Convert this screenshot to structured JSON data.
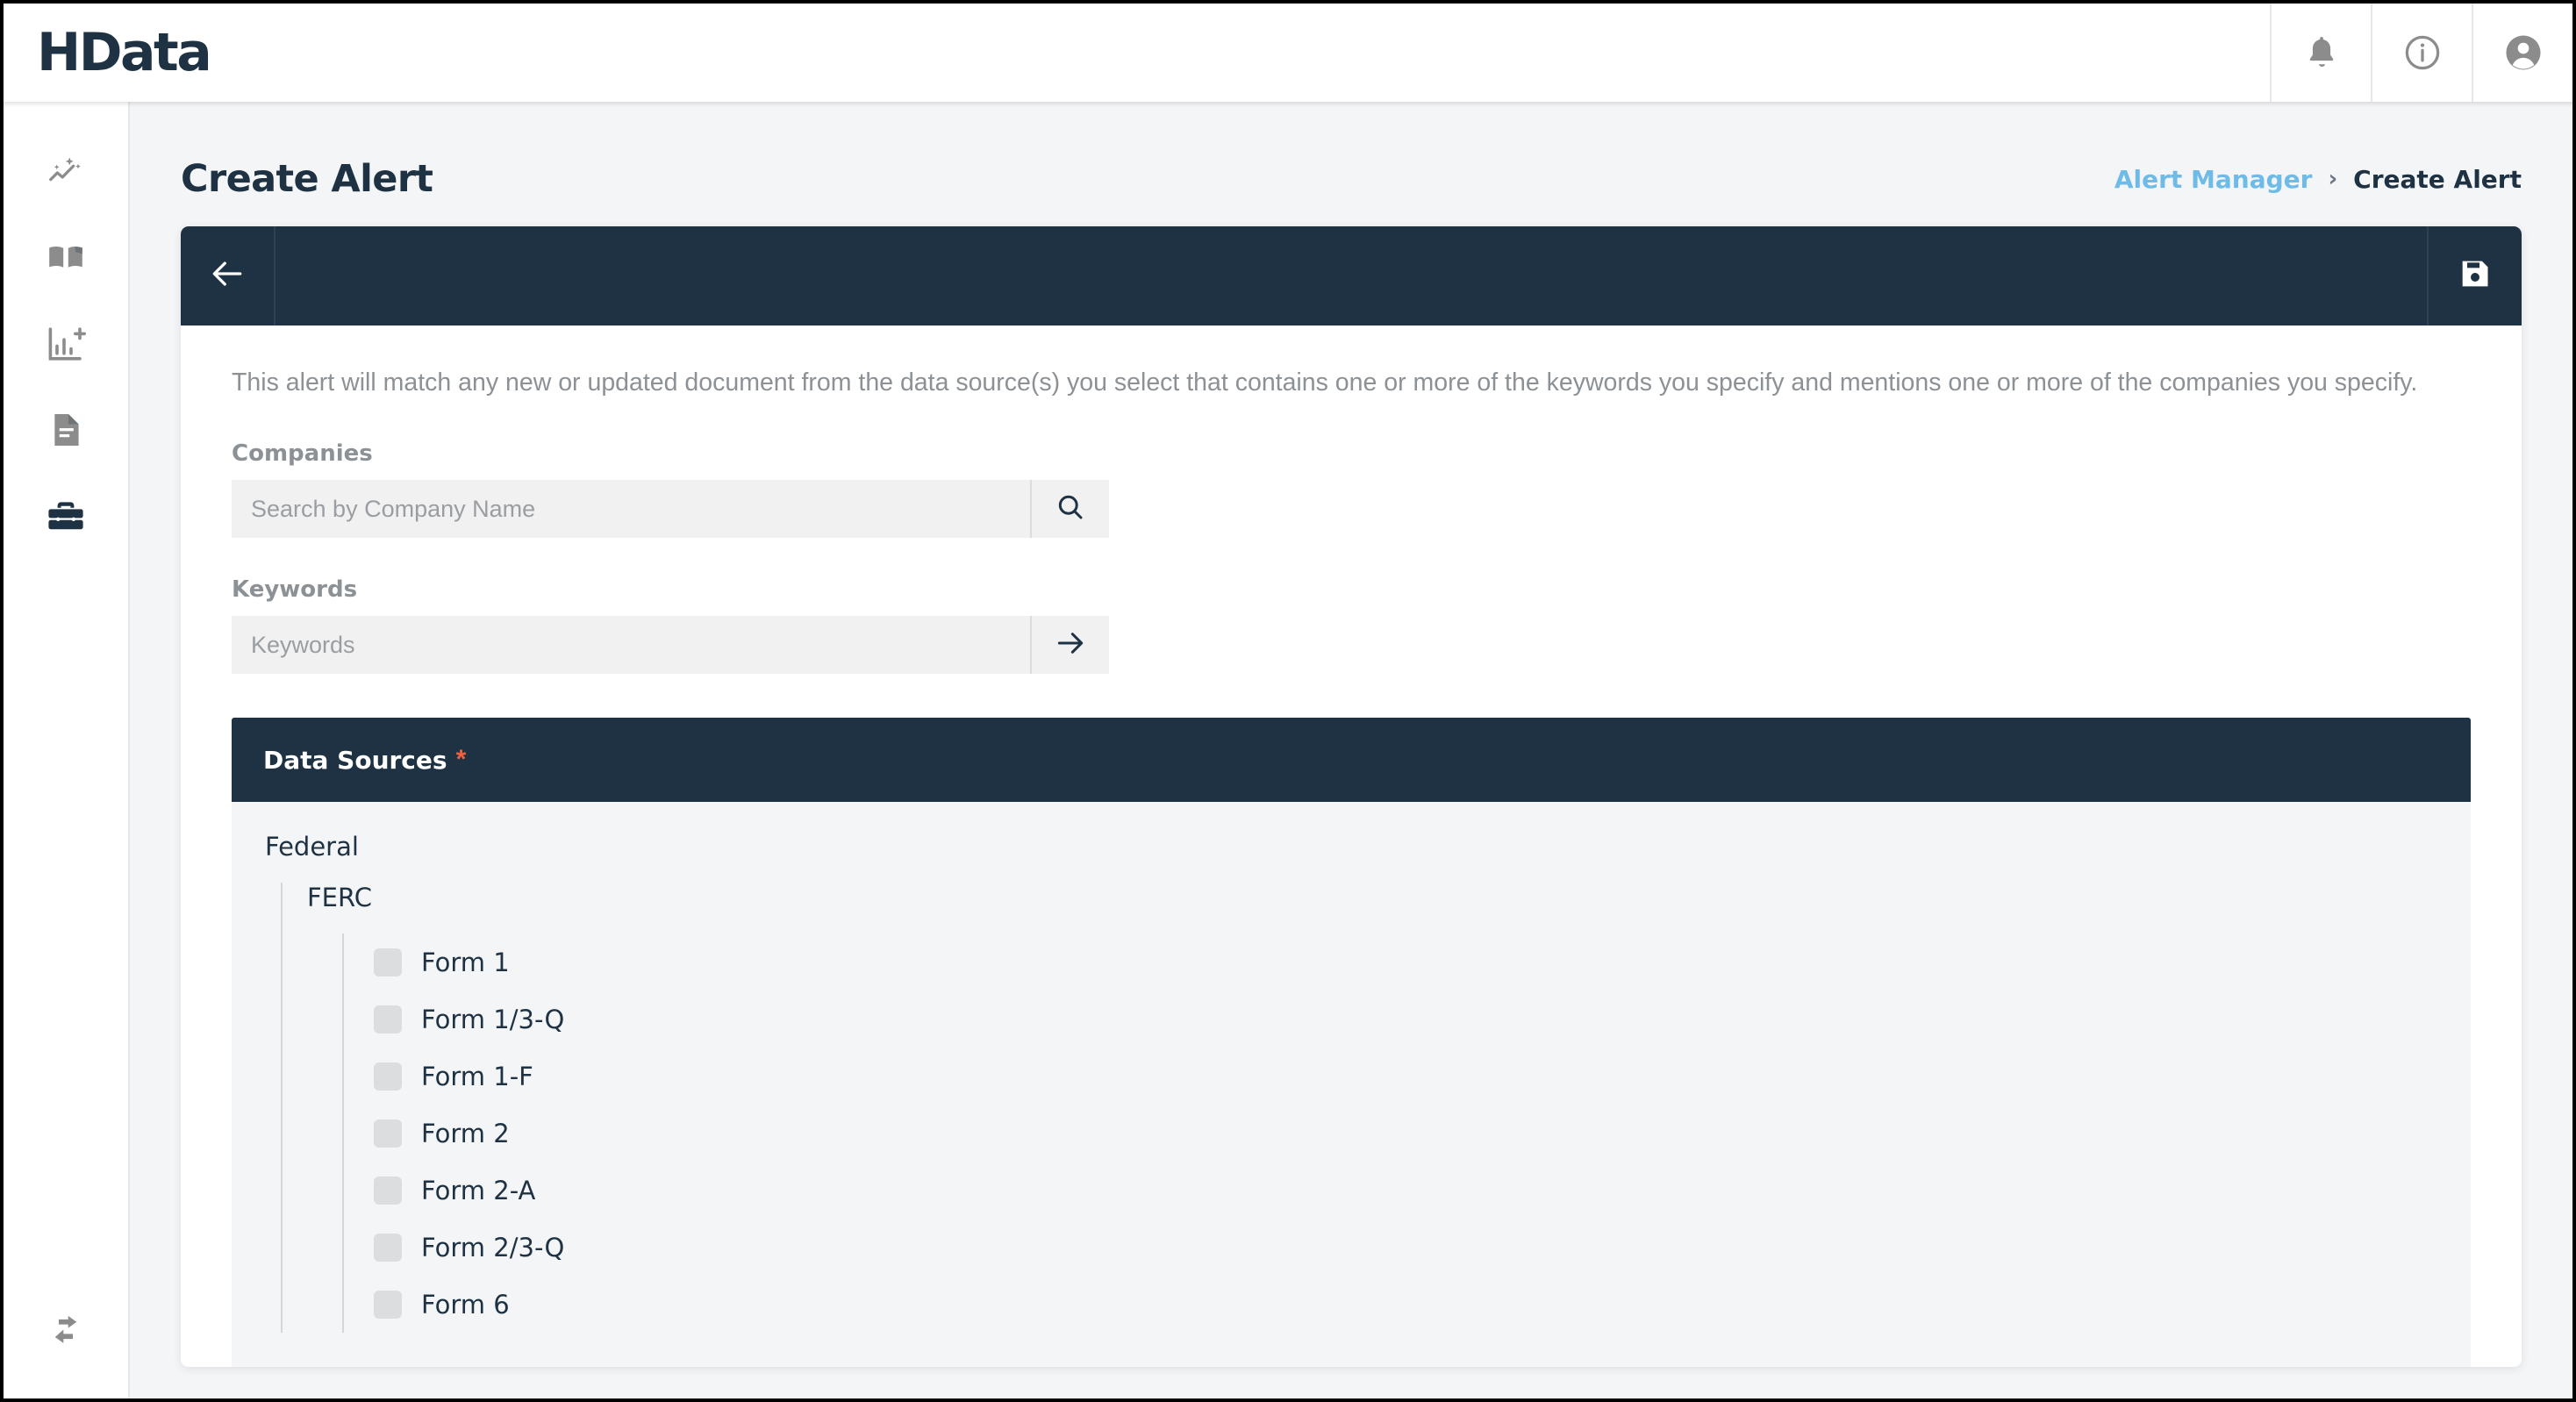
{
  "brand": {
    "logo_text": "HData"
  },
  "header": {
    "icons": [
      {
        "name": "notifications-bell-icon",
        "label": "Notifications"
      },
      {
        "name": "info-circle-icon",
        "label": "Help / Info"
      },
      {
        "name": "account-avatar-icon",
        "label": "Account"
      }
    ]
  },
  "sidebar": {
    "items": [
      {
        "name": "insights-sparkle-icon",
        "label": "Insights",
        "active": false
      },
      {
        "name": "book-icon",
        "label": "Library",
        "active": false
      },
      {
        "name": "chart-add-icon",
        "label": "New Chart",
        "active": false
      },
      {
        "name": "document-icon",
        "label": "Documents",
        "active": false
      },
      {
        "name": "briefcase-icon",
        "label": "Workspace",
        "active": true
      }
    ],
    "collapse_toggle": {
      "name": "collapse-expand-arrows-icon",
      "label": "Collapse / Expand"
    }
  },
  "page": {
    "title": "Create Alert",
    "breadcrumb": {
      "parent": "Alert Manager",
      "separator": "›",
      "current": "Create Alert"
    }
  },
  "toolbar": {
    "back_label": "Back",
    "save_label": "Save"
  },
  "form": {
    "description": "This alert will match any new or updated document from the data source(s) you select that contains one or more of the keywords you specify and mentions one or more of the companies you specify.",
    "companies": {
      "label": "Companies",
      "placeholder": "Search by Company Name",
      "value": "",
      "button_icon": "search-icon"
    },
    "keywords": {
      "label": "Keywords",
      "placeholder": "Keywords",
      "value": "",
      "button_icon": "arrow-right-icon"
    }
  },
  "data_sources": {
    "title": "Data Sources",
    "required_marker": "*",
    "groups": [
      {
        "label": "Federal",
        "subgroups": [
          {
            "label": "FERC",
            "items": [
              {
                "label": "Form 1",
                "checked": false
              },
              {
                "label": "Form 1/3-Q",
                "checked": false
              },
              {
                "label": "Form 1-F",
                "checked": false
              },
              {
                "label": "Form 2",
                "checked": false
              },
              {
                "label": "Form 2-A",
                "checked": false
              },
              {
                "label": "Form 2/3-Q",
                "checked": false
              },
              {
                "label": "Form 6",
                "checked": false
              }
            ]
          }
        ]
      }
    ]
  },
  "colors": {
    "navy": "#1e3243",
    "accent_blue": "#6fbbe8",
    "required_red": "#f4603e",
    "page_bg": "#f4f5f7",
    "input_bg": "#f1f1f2",
    "muted_text": "#8c9196"
  }
}
